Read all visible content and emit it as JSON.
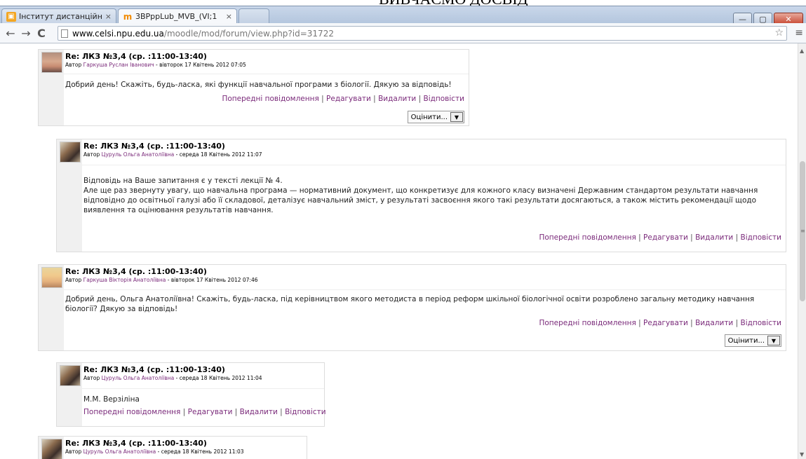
{
  "caption": "ВИВЧАЄМО ДОСВІД",
  "browser": {
    "tabs": [
      {
        "title": "Інститут дистанційн",
        "icon": "institute-favicon"
      },
      {
        "title": "3BPppLub_MVB_(VI;1",
        "icon": "moodle-favicon"
      }
    ],
    "address": {
      "host": "www.celsi.npu.edu.ua",
      "path": "/moodle/mod/forum/view.php?id=31722"
    }
  },
  "links_prev": "Попередні повідомлення",
  "links_edit": "Редагувати",
  "links_delete": "Видалити",
  "links_reply": "Відповісти",
  "rate_label": "Оцінити...",
  "posts": [
    {
      "subject": "Re: ЛКЗ №3,4 (ср. :11:00-13:40)",
      "author_prefix": "Автор",
      "author_name": "Гаркуша Руслан Іванович",
      "date": "вівторок 17 Квітень 2012 07:05",
      "body": "Добрий день! Скажіть, будь-ласка, які функції навчальної програми з біології. Дякую за відповідь!"
    },
    {
      "subject": "Re: ЛКЗ №3,4 (ср. :11:00-13:40)",
      "author_prefix": "Автор",
      "author_name": "Цуруль Ольга Анатоліївна",
      "date": "середа 18 Квітень 2012 11:07",
      "body1": "Відповідь на Ваше запитання є у тексті лекції № 4.",
      "body2": "Але ще раз звернуту увагу, що навчальна програма — нормативний документ, що конкретизує для кожного класу визначені Державним стандартом результати навчання відповідно до освітньої галузі або її складової, деталізує навчальний зміст, у результаті засвоєння якого такі результати досягаються, а також містить рекомендації щодо виявлення та оцінювання результатів навчання."
    },
    {
      "subject": "Re: ЛКЗ №3,4 (ср. :11:00-13:40)",
      "author_prefix": "Автор",
      "author_name": "Гаркуша Вікторія Анатоліївна",
      "date": "вівторок 17 Квітень 2012 07:46",
      "body": "Добрий день, Ольга Анатоліївна! Скажіть, будь-ласка, під керівництвом якого методиста в період реформ шкільної біологічної освіти розроблено загальну методику навчання біології? Дякую за відповідь!"
    },
    {
      "subject": "Re: ЛКЗ №3,4 (ср. :11:00-13:40)",
      "author_prefix": "Автор",
      "author_name": "Цуруль Ольга Анатоліївна",
      "date": "середа 18 Квітень 2012 11:04",
      "body": "М.М. Верзіліна"
    },
    {
      "subject": "Re: ЛКЗ №3,4 (ср. :11:00-13:40)",
      "author_prefix": "Автор",
      "author_name": "Цуруль Ольга Анатоліївна",
      "date": "середа 18 Квітень 2012 11:03"
    }
  ]
}
